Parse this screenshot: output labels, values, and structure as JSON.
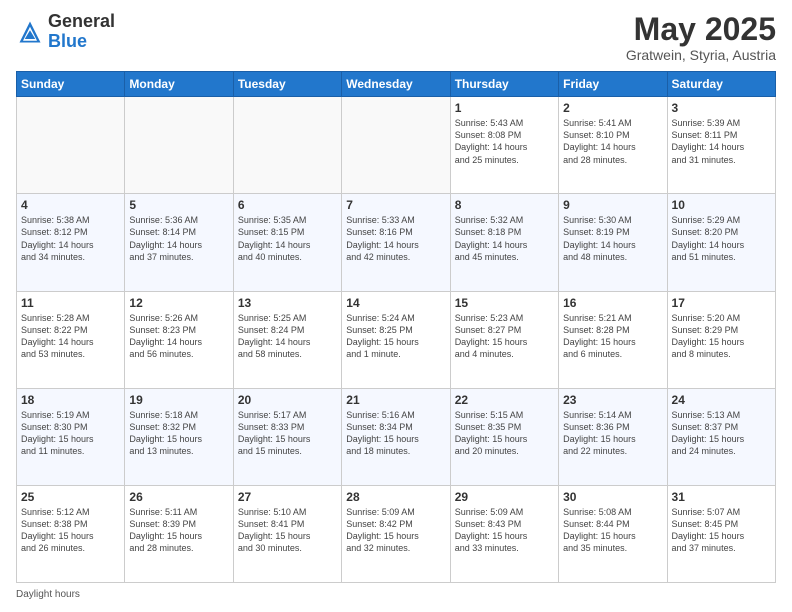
{
  "header": {
    "logo_general": "General",
    "logo_blue": "Blue",
    "month_title": "May 2025",
    "location": "Gratwein, Styria, Austria"
  },
  "days_of_week": [
    "Sunday",
    "Monday",
    "Tuesday",
    "Wednesday",
    "Thursday",
    "Friday",
    "Saturday"
  ],
  "weeks": [
    [
      {
        "day": "",
        "info": ""
      },
      {
        "day": "",
        "info": ""
      },
      {
        "day": "",
        "info": ""
      },
      {
        "day": "",
        "info": ""
      },
      {
        "day": "1",
        "info": "Sunrise: 5:43 AM\nSunset: 8:08 PM\nDaylight: 14 hours\nand 25 minutes."
      },
      {
        "day": "2",
        "info": "Sunrise: 5:41 AM\nSunset: 8:10 PM\nDaylight: 14 hours\nand 28 minutes."
      },
      {
        "day": "3",
        "info": "Sunrise: 5:39 AM\nSunset: 8:11 PM\nDaylight: 14 hours\nand 31 minutes."
      }
    ],
    [
      {
        "day": "4",
        "info": "Sunrise: 5:38 AM\nSunset: 8:12 PM\nDaylight: 14 hours\nand 34 minutes."
      },
      {
        "day": "5",
        "info": "Sunrise: 5:36 AM\nSunset: 8:14 PM\nDaylight: 14 hours\nand 37 minutes."
      },
      {
        "day": "6",
        "info": "Sunrise: 5:35 AM\nSunset: 8:15 PM\nDaylight: 14 hours\nand 40 minutes."
      },
      {
        "day": "7",
        "info": "Sunrise: 5:33 AM\nSunset: 8:16 PM\nDaylight: 14 hours\nand 42 minutes."
      },
      {
        "day": "8",
        "info": "Sunrise: 5:32 AM\nSunset: 8:18 PM\nDaylight: 14 hours\nand 45 minutes."
      },
      {
        "day": "9",
        "info": "Sunrise: 5:30 AM\nSunset: 8:19 PM\nDaylight: 14 hours\nand 48 minutes."
      },
      {
        "day": "10",
        "info": "Sunrise: 5:29 AM\nSunset: 8:20 PM\nDaylight: 14 hours\nand 51 minutes."
      }
    ],
    [
      {
        "day": "11",
        "info": "Sunrise: 5:28 AM\nSunset: 8:22 PM\nDaylight: 14 hours\nand 53 minutes."
      },
      {
        "day": "12",
        "info": "Sunrise: 5:26 AM\nSunset: 8:23 PM\nDaylight: 14 hours\nand 56 minutes."
      },
      {
        "day": "13",
        "info": "Sunrise: 5:25 AM\nSunset: 8:24 PM\nDaylight: 14 hours\nand 58 minutes."
      },
      {
        "day": "14",
        "info": "Sunrise: 5:24 AM\nSunset: 8:25 PM\nDaylight: 15 hours\nand 1 minute."
      },
      {
        "day": "15",
        "info": "Sunrise: 5:23 AM\nSunset: 8:27 PM\nDaylight: 15 hours\nand 4 minutes."
      },
      {
        "day": "16",
        "info": "Sunrise: 5:21 AM\nSunset: 8:28 PM\nDaylight: 15 hours\nand 6 minutes."
      },
      {
        "day": "17",
        "info": "Sunrise: 5:20 AM\nSunset: 8:29 PM\nDaylight: 15 hours\nand 8 minutes."
      }
    ],
    [
      {
        "day": "18",
        "info": "Sunrise: 5:19 AM\nSunset: 8:30 PM\nDaylight: 15 hours\nand 11 minutes."
      },
      {
        "day": "19",
        "info": "Sunrise: 5:18 AM\nSunset: 8:32 PM\nDaylight: 15 hours\nand 13 minutes."
      },
      {
        "day": "20",
        "info": "Sunrise: 5:17 AM\nSunset: 8:33 PM\nDaylight: 15 hours\nand 15 minutes."
      },
      {
        "day": "21",
        "info": "Sunrise: 5:16 AM\nSunset: 8:34 PM\nDaylight: 15 hours\nand 18 minutes."
      },
      {
        "day": "22",
        "info": "Sunrise: 5:15 AM\nSunset: 8:35 PM\nDaylight: 15 hours\nand 20 minutes."
      },
      {
        "day": "23",
        "info": "Sunrise: 5:14 AM\nSunset: 8:36 PM\nDaylight: 15 hours\nand 22 minutes."
      },
      {
        "day": "24",
        "info": "Sunrise: 5:13 AM\nSunset: 8:37 PM\nDaylight: 15 hours\nand 24 minutes."
      }
    ],
    [
      {
        "day": "25",
        "info": "Sunrise: 5:12 AM\nSunset: 8:38 PM\nDaylight: 15 hours\nand 26 minutes."
      },
      {
        "day": "26",
        "info": "Sunrise: 5:11 AM\nSunset: 8:39 PM\nDaylight: 15 hours\nand 28 minutes."
      },
      {
        "day": "27",
        "info": "Sunrise: 5:10 AM\nSunset: 8:41 PM\nDaylight: 15 hours\nand 30 minutes."
      },
      {
        "day": "28",
        "info": "Sunrise: 5:09 AM\nSunset: 8:42 PM\nDaylight: 15 hours\nand 32 minutes."
      },
      {
        "day": "29",
        "info": "Sunrise: 5:09 AM\nSunset: 8:43 PM\nDaylight: 15 hours\nand 33 minutes."
      },
      {
        "day": "30",
        "info": "Sunrise: 5:08 AM\nSunset: 8:44 PM\nDaylight: 15 hours\nand 35 minutes."
      },
      {
        "day": "31",
        "info": "Sunrise: 5:07 AM\nSunset: 8:45 PM\nDaylight: 15 hours\nand 37 minutes."
      }
    ]
  ],
  "footer": {
    "daylight_label": "Daylight hours"
  }
}
